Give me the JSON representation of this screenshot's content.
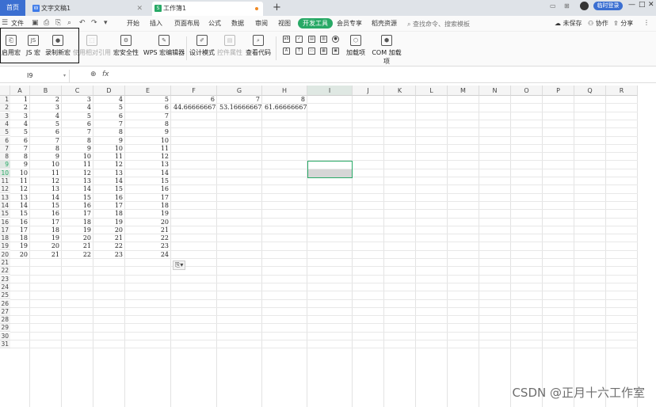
{
  "titlebar": {
    "home_tab": "首页",
    "tabs": [
      {
        "label": "文字文稿1",
        "icon": "writer-doc-icon"
      },
      {
        "label": "工作簿1",
        "icon": "spreadsheet-icon"
      }
    ],
    "new_tab": "+",
    "login_button": "临时登录"
  },
  "menu": {
    "file": "文件",
    "items": [
      "开始",
      "插入",
      "页面布局",
      "公式",
      "数据",
      "审阅",
      "视图",
      "开发工具",
      "会员专享",
      "稻壳资源"
    ],
    "active": "开发工具",
    "search_placeholder": "查找命令、搜索模板",
    "right": {
      "unsaved": "未保存",
      "collab": "协作",
      "share": "分享"
    }
  },
  "ribbon": {
    "buttons": [
      {
        "label": "启用宏",
        "icon": "enable-macro-icon",
        "enabled": true
      },
      {
        "label": "JS 宏",
        "icon": "js-macro-icon",
        "enabled": true
      },
      {
        "label": "录制新宏",
        "icon": "record-macro-icon",
        "enabled": true
      },
      {
        "label": "使用相对引用",
        "icon": "relative-ref-icon",
        "enabled": false
      },
      {
        "label": "宏安全性",
        "icon": "macro-security-icon",
        "enabled": true
      },
      {
        "label": "WPS 宏编辑器",
        "icon": "macro-editor-icon",
        "enabled": true
      },
      {
        "label": "设计模式",
        "icon": "design-mode-icon",
        "enabled": true
      },
      {
        "label": "控件属性",
        "icon": "control-properties-icon",
        "enabled": false
      },
      {
        "label": "查看代码",
        "icon": "view-code-icon",
        "enabled": true
      },
      {
        "label": "加载项",
        "icon": "addins-icon",
        "enabled": true
      },
      {
        "label": "COM 加载项",
        "icon": "com-addins-icon",
        "enabled": true
      }
    ]
  },
  "formula_bar": {
    "name_box": "I9",
    "fx": "fx",
    "formula": ""
  },
  "sheet": {
    "columns": [
      "A",
      "B",
      "C",
      "D",
      "E",
      "F",
      "G",
      "H",
      "I",
      "J",
      "K",
      "L",
      "M",
      "N",
      "O",
      "P",
      "Q",
      "R"
    ],
    "selected_column": "I",
    "selected_rows": [
      "9",
      "10"
    ],
    "row_count": 31,
    "data_rows": [
      [
        "1",
        "2",
        "3",
        "4",
        "5",
        "6",
        "7",
        "8"
      ],
      [
        "2",
        "3",
        "4",
        "5",
        "6",
        "44.66666667",
        "53.16666667",
        "61.66666667"
      ],
      [
        "3",
        "4",
        "5",
        "6",
        "7"
      ],
      [
        "4",
        "5",
        "6",
        "7",
        "8"
      ],
      [
        "5",
        "6",
        "7",
        "8",
        "9"
      ],
      [
        "6",
        "7",
        "8",
        "9",
        "10"
      ],
      [
        "7",
        "8",
        "9",
        "10",
        "11"
      ],
      [
        "8",
        "9",
        "10",
        "11",
        "12"
      ],
      [
        "9",
        "10",
        "11",
        "12",
        "13"
      ],
      [
        "10",
        "11",
        "12",
        "13",
        "14"
      ],
      [
        "11",
        "12",
        "13",
        "14",
        "15"
      ],
      [
        "12",
        "13",
        "14",
        "15",
        "16"
      ],
      [
        "13",
        "14",
        "15",
        "16",
        "17"
      ],
      [
        "14",
        "15",
        "16",
        "17",
        "18"
      ],
      [
        "15",
        "16",
        "17",
        "18",
        "19"
      ],
      [
        "16",
        "17",
        "18",
        "19",
        "20"
      ],
      [
        "17",
        "18",
        "19",
        "20",
        "21"
      ],
      [
        "18",
        "19",
        "20",
        "21",
        "22"
      ],
      [
        "19",
        "20",
        "21",
        "22",
        "23"
      ],
      [
        "20",
        "21",
        "22",
        "23",
        "24"
      ]
    ],
    "accent_color": "#28a966"
  },
  "watermark": "CSDN @正月十六工作室"
}
